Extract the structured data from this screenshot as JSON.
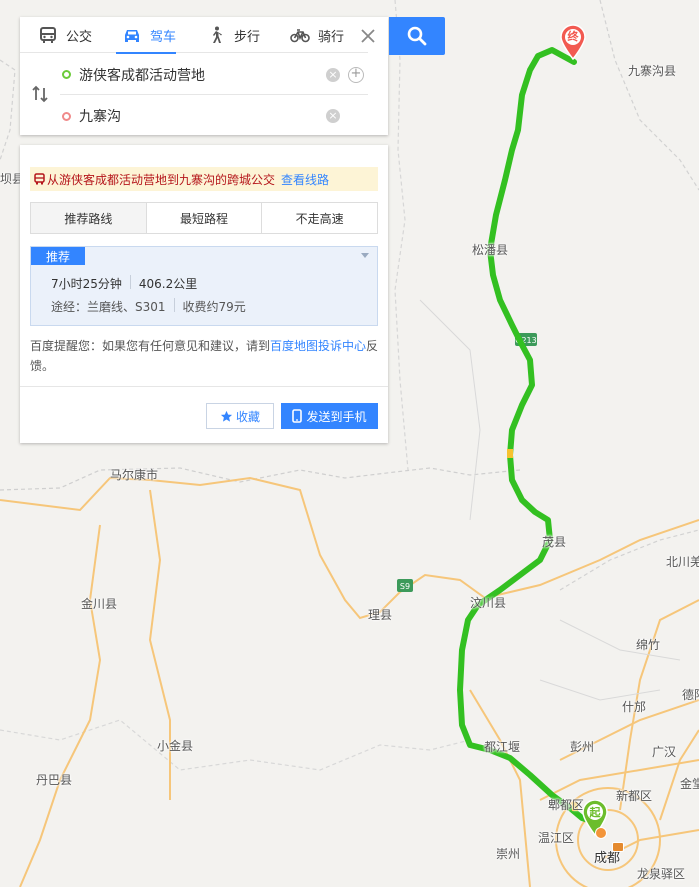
{
  "modes": [
    {
      "label": "公交",
      "icon": "bus-icon",
      "active": false
    },
    {
      "label": "驾车",
      "icon": "car-icon",
      "active": true
    },
    {
      "label": "步行",
      "icon": "walk-icon",
      "active": false
    },
    {
      "label": "骑行",
      "icon": "bike-icon",
      "active": false
    }
  ],
  "route": {
    "start_value": "游侠客成都活动营地",
    "end_value": "九寨沟"
  },
  "bus_tip": {
    "text": "从游侠客成都活动营地到九寨沟的跨城公交",
    "link": "查看线路"
  },
  "strategies": [
    "推荐路线",
    "最短路程",
    "不走高速"
  ],
  "plan": {
    "tag": "推荐",
    "duration": "7小时25分钟",
    "distance": "406.2公里",
    "via": "途经：兰磨线、S301",
    "toll": "收费约79元"
  },
  "feedback": {
    "prefix": "百度提醒您：如果您有任何意见和建议，请到",
    "link": "百度地图投诉中心",
    "suffix": "反馈。"
  },
  "actions": {
    "favorite": "收藏",
    "send": "发送到手机"
  },
  "map": {
    "route_color": "#33c021",
    "labels": {
      "jiuzhaigou_county": "九寨沟县",
      "songpan": "松潘县",
      "maoxian": "茂县",
      "wenchuan": "汶川县",
      "dujiangyan": "都江堰",
      "pixian": "郫都区",
      "wenjiang": "温江区",
      "chengdu": "成都",
      "chongzhou": "崇州",
      "xindu": "新都区",
      "pengzhou": "彭州",
      "shifang": "什邡",
      "mianzhu": "绵竹",
      "guanghan": "广汉",
      "beichuan": "北川羌",
      "deyang": "德阳",
      "jintang": "金堂",
      "longquanyi": "龙泉驿区",
      "lixian": "理县",
      "jinchuan": "金川县",
      "xiaojin": "小金县",
      "danba": "丹巴县",
      "barkam": "马尔康市",
      "partial_left": "坝县"
    },
    "shields": {
      "g213": "G213",
      "s9": "S9"
    },
    "markers": {
      "start": "起",
      "end": "终"
    }
  }
}
